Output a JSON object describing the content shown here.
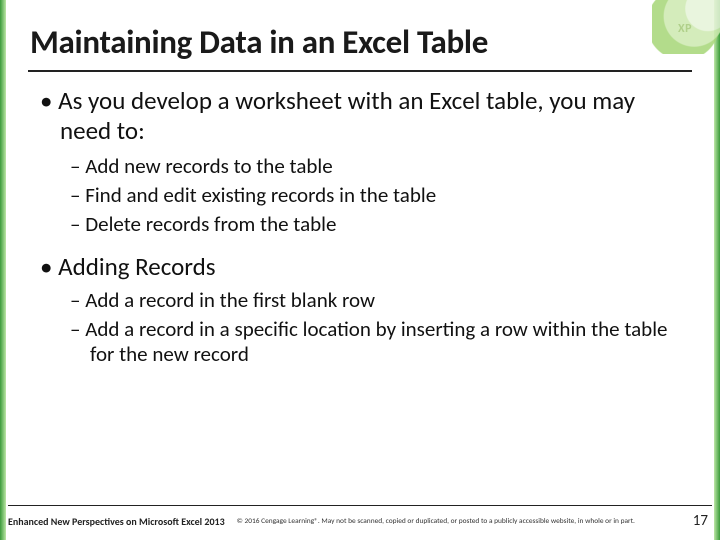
{
  "title": "Maintaining Data in an Excel Table",
  "bullets": {
    "b1": "As you develop a worksheet with an Excel table, you may need to:",
    "b1_sub": [
      "Add new records to the table",
      "Find and edit existing records in the table",
      "Delete records from the table"
    ],
    "b2": "Adding Records",
    "b2_sub": [
      "Add a record in the first blank row",
      "Add a record in a specific location by inserting a row within the table for the new record"
    ]
  },
  "decor": {
    "xp_label": "XP"
  },
  "footer": {
    "left": "Enhanced New Perspectives on Microsoft Excel 2013",
    "mid": "© 2016 Cengage Learning®. May not be scanned, copied or duplicated, or posted to a publicly accessible website, in whole or in part.",
    "page": "17"
  }
}
